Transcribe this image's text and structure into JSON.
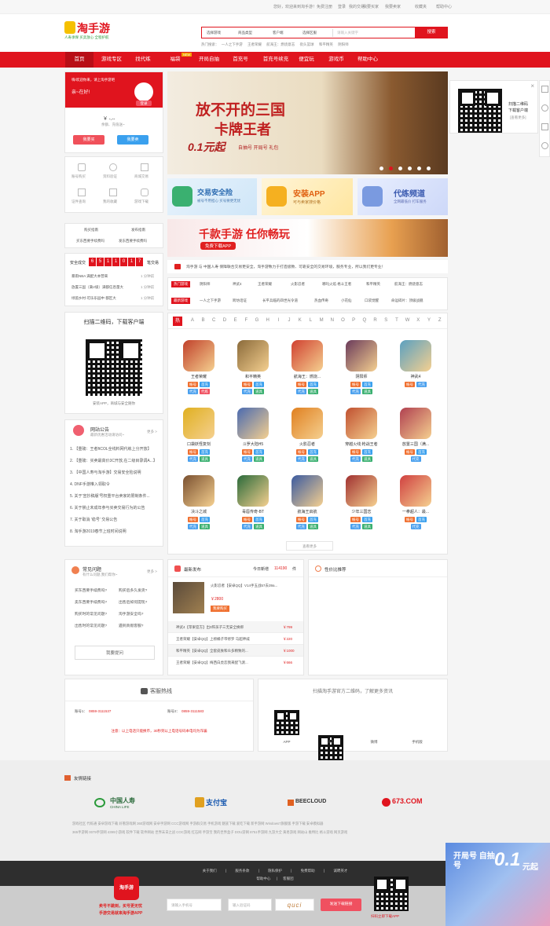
{
  "topbar": {
    "welcome": "您好，欢迎来到淘手游！",
    "register": "免费注册",
    "login": "登录",
    "my_trades": "我的交易",
    "buy": "我要买家",
    "sell": "我要卖家",
    "collect": "收藏夹",
    "help": "帮助中心"
  },
  "logo": {
    "name": "淘手游",
    "slogan": "人寿承保 买卖放心 全程护航"
  },
  "search": {
    "sel1": "选择游戏",
    "sel2": "商品类型",
    "sel3": "客户端",
    "sel4": "选择区服",
    "placeholder": "请输入关键字",
    "button": "搜索",
    "hot_label": "热门搜索：",
    "hot": [
      "一人之下手游",
      "王者荣耀",
      "航海王：燃烧意志",
      "街头篮球",
      "和平精英",
      "阴阳师"
    ]
  },
  "nav": [
    "首页",
    "游戏专区",
    "找代练",
    "福袋",
    "开局自抽",
    "首充号",
    "首充号续充",
    "便宜玩",
    "游戏币",
    "帮助中心"
  ],
  "nav_badge": "NEW",
  "user": {
    "greet": "嗨!欢迎你来，请上淘手游吧",
    "sub": "亲~在好!",
    "login_btn": "登录",
    "balance": "￥ -.--",
    "bal_label": "余额、充值送~",
    "buy_btn": "我要买",
    "sell_btn": "我要卖",
    "icons": [
      "账号购买",
      "资料验证",
      "商城交易",
      "证件查询",
      "我的收藏",
      "游戏下载"
    ]
  },
  "guides": {
    "items": [
      "购买指南",
      "发布指南",
      "买东西要手续费吗",
      "发东西要手续费吗"
    ]
  },
  "trades": {
    "label": "安全成交",
    "digits": [
      "6",
      "5",
      "1",
      "1",
      "0",
      "1",
      "7"
    ],
    "suffix": "笔交易",
    "rows": [
      {
        "t": "暴雨NBA 满配大本营来",
        "s": "1 分钟前"
      },
      {
        "t": "放置三国（满V级）满都信息量大",
        "s": "1 分钟前"
      },
      {
        "t": "绿茵乡村-可乐乐园中 都区大",
        "s": "1 分钟前"
      }
    ]
  },
  "app_box": {
    "title": "扫描二维码，下载客户端",
    "sub": "安装APP，商城与安全随你"
  },
  "notice": {
    "title": "网站公告",
    "sub": "最新优惠活动请访问~",
    "more": "更多 >",
    "items": [
      "1. 【重磅：王者ftCOL全线料网代练上分开放】",
      "2. 【重磅：买卖最高价3C开放,在二级目录调A...】",
      "3. 【中国人寿与淘手游】交易安全险说明",
      "4. DNF手游推入领取令",
      "5. 关于'宣抄稿版'号权重平台卖家的限制条件...",
      "6. 关于禁止未成年参与买卖交易行为的公告",
      "7. 关于取消 '稳号' 交易公告",
      "8. 淘手游2019春节上班时间说明"
    ]
  },
  "banner": {
    "line1": "放不开的三国",
    "line2": "卡牌王者",
    "line3": "0.1元起",
    "line4": "自抽号 开局号 礼包"
  },
  "features": [
    {
      "t": "交易安全险",
      "s": "被号不用担心 买号要更无忧"
    },
    {
      "t": "安装APP",
      "s": "可与卖家搜价格"
    },
    {
      "t": "代练频道",
      "s": "全网最低价 打车服务"
    }
  ],
  "ad": {
    "t": "千款手游 任你畅玩",
    "btn": "免费下载APP"
  },
  "scroll": {
    "text": "淘手游 与 中国人寿 保障联合交易更安全，淘手游致力于打造极致、可靠安全的交易环境，服务专业，所以我们更专业！"
  },
  "hot_rows": [
    {
      "label": "热门游戏",
      "items": [
        "阴阳师",
        "神武4",
        "王者荣耀",
        "火影忍者",
        "哪吒火焰 格斗王者",
        "和平精英",
        "航海王：燃烧意志"
      ]
    },
    {
      "label": "最新游戏",
      "items": [
        "一人之下手游",
        "跨坊话证",
        "长平兵临的四世光令道",
        "热血传奇",
        "小花仙",
        "口袋觉醒",
        "命运碎片：顶级战舰"
      ]
    }
  ],
  "alpha": {
    "hot": "热",
    "letters": [
      "A",
      "B",
      "C",
      "D",
      "E",
      "F",
      "G",
      "H",
      "I",
      "J",
      "K",
      "L",
      "M",
      "N",
      "O",
      "P",
      "Q",
      "R",
      "S",
      "T",
      "W",
      "X",
      "Y",
      "Z"
    ]
  },
  "games": [
    {
      "n": "王者荣耀",
      "c": "#c0402a",
      "t": [
        "帐号",
        "首充",
        "代充",
        "代练"
      ]
    },
    {
      "n": "和平精英",
      "c": "#8a6a3a",
      "t": [
        "帐号",
        "首充",
        "代充",
        "道具"
      ]
    },
    {
      "n": "航海王：燃烧...",
      "c": "#d04030",
      "t": [
        "帐号",
        "首充",
        "代充",
        "道具"
      ]
    },
    {
      "n": "阴阳师",
      "c": "#6a3a5a",
      "t": [
        "帐号",
        "首充",
        "代充",
        "道具"
      ]
    },
    {
      "n": "神武4",
      "c": "#5aa0c0",
      "t": [
        "帐号",
        "代充"
      ]
    },
    {
      "n": "口袋妖怪复刻",
      "c": "#e0b020",
      "t": [
        "帐号",
        "首充",
        "代充",
        "道具"
      ]
    },
    {
      "n": "斗罗大陆H5",
      "c": "#4a6ab0",
      "t": [
        "帐号",
        "首充",
        "代充",
        "道具"
      ]
    },
    {
      "n": "火影忍者",
      "c": "#e08020",
      "t": [
        "帐号",
        "首充",
        "代充",
        "道具"
      ]
    },
    {
      "n": "穿越火线:枪战王者",
      "c": "#c05030",
      "t": [
        "帐号",
        "首充",
        "代充",
        "道具"
      ]
    },
    {
      "n": "放置三国（满...",
      "c": "#b04050",
      "t": [
        "帐号",
        "首充",
        "代充"
      ]
    },
    {
      "n": "决斗之城",
      "c": "#7a5030",
      "t": [
        "帐号",
        "首充",
        "代充",
        "道具"
      ]
    },
    {
      "n": "毒唇传奇-BT",
      "c": "#2a6a3a",
      "t": [
        "帐号",
        "首充",
        "代充",
        "道具"
      ]
    },
    {
      "n": "航海王启航",
      "c": "#3a5aa0",
      "t": [
        "帐号",
        "首充",
        "代充",
        "道具"
      ]
    },
    {
      "n": "少年三国志",
      "c": "#a03030",
      "t": [
        "帐号",
        "首充",
        "代充",
        "道具"
      ]
    },
    {
      "n": "一拳超人：最...",
      "c": "#d04040",
      "t": [
        "帐号",
        "首充",
        "代充"
      ]
    }
  ],
  "more_btn": "查看更多",
  "faq": {
    "title": "常见问题",
    "sub": "有什么问题,我们帮你~",
    "more": "更多 >",
    "items": [
      "买东西要手续费吗?",
      "购买后多久发货?",
      "卖东西要手续费吗?",
      "出售后如何提现?",
      "购买时的常见问题?",
      "淘手游安全吗?",
      "出售时的常见问题?",
      "遇到真假客服?"
    ],
    "ask": "我要提问"
  },
  "latest": {
    "title": "最新发布",
    "today": "今日新增",
    "count": "114190",
    "unit": "件",
    "featured": {
      "t": "火影忍者【安卓QQ】V14手五战57去39a...",
      "p": "￥2800",
      "btn": "我要购买"
    },
    "rows": [
      {
        "t": "神武4【苹果官方】出0阵孩子三无安全换绑",
        "p": "￥799"
      },
      {
        "t": "王者荣耀【安卓QQ】上榜橘子带修罗 马超神威",
        "p": "￥220"
      },
      {
        "t": "和平精英【安卓QQ】全套皮肤和众多精致的...",
        "p": "￥1000"
      },
      {
        "t": "王者荣耀【安卓QQ】梅西白虎恋我来配飞渡...",
        "p": "￥666"
      }
    ]
  },
  "value": {
    "title": "性价比推荐"
  },
  "hotline": {
    "title": "客服热线",
    "l1": "账号1：",
    "n1": "0859-3111537",
    "l2": "账号2：",
    "n2": "0859-3111583",
    "note": "注意：以上电话只能换币，30秒到以上电话号码本电均为诈骗"
  },
  "qrs": {
    "title": "扫描淘手游官方二维码，了解更多资讯",
    "items": [
      "APP",
      "微信",
      "微博",
      "手机版"
    ]
  },
  "links": {
    "title": "友情链接",
    "logos": [
      "中国人寿",
      "支付宝",
      "BEECLOUD",
      "673.COM"
    ],
    "logo_sub": "CHINA LIFE",
    "text1": "游戏社区 代练通 安卓游戏下载 好看游戏网 360游戏网 安卓手游网 CCC游戏网 手游群交易 手机游戏 魅族下载 爱吃下载 新手游网 Windows7旗舰版 手游下载 安卓模拟器",
    "text2": "365手游网 0079手游网 4399小游戏 软件下载 软件网站 世界末日之战 COC游戏 红石网 手游宝 我的世界盒子 DOU游网 8751手游网 九游大全 黄易游戏 网站山 推特比 格斗游戏 网页游戏"
  },
  "footer": {
    "links": [
      "关于我们",
      "服务条款",
      "隐私保护",
      "免费帮助",
      "诚聘英才"
    ],
    "links2": [
      "帮助中心",
      "客服团"
    ]
  },
  "bottom": {
    "promo1": "卖号不跳到，买号更无忧",
    "promo2": "手游交易就来淘手游APP",
    "phone_ph": "请输入手机号",
    "code_ph": "输入验证码",
    "captcha": "quci",
    "dl_btn": "发送下载链接",
    "qr_cap": "扫码立即下载APP"
  },
  "float_ad": {
    "t": "开局号 自抽号",
    "n": "0.1",
    "u": "元起"
  },
  "side_qr": {
    "t1": "扫描二维码",
    "t2": "下载客户端",
    "t3": "[查看更多]",
    "close": "×"
  }
}
